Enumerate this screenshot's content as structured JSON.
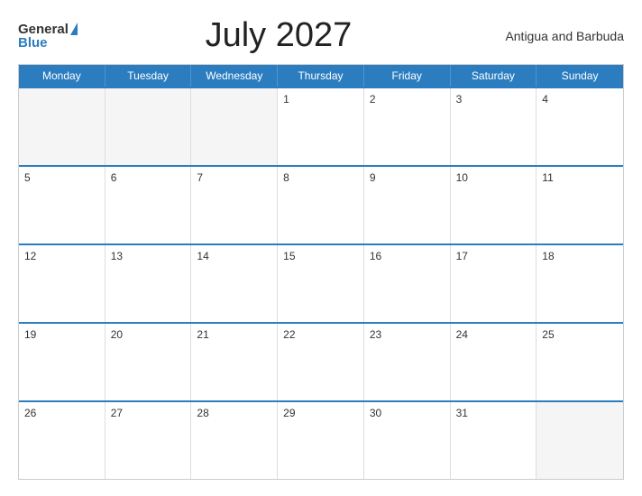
{
  "header": {
    "logo_general": "General",
    "logo_blue": "Blue",
    "month_title": "July 2027",
    "country": "Antigua and Barbuda"
  },
  "calendar": {
    "weekdays": [
      "Monday",
      "Tuesday",
      "Wednesday",
      "Thursday",
      "Friday",
      "Saturday",
      "Sunday"
    ],
    "weeks": [
      [
        "",
        "",
        "",
        "1",
        "2",
        "3",
        "4"
      ],
      [
        "5",
        "6",
        "7",
        "8",
        "9",
        "10",
        "11"
      ],
      [
        "12",
        "13",
        "14",
        "15",
        "16",
        "17",
        "18"
      ],
      [
        "19",
        "20",
        "21",
        "22",
        "23",
        "24",
        "25"
      ],
      [
        "26",
        "27",
        "28",
        "29",
        "30",
        "31",
        ""
      ]
    ]
  }
}
